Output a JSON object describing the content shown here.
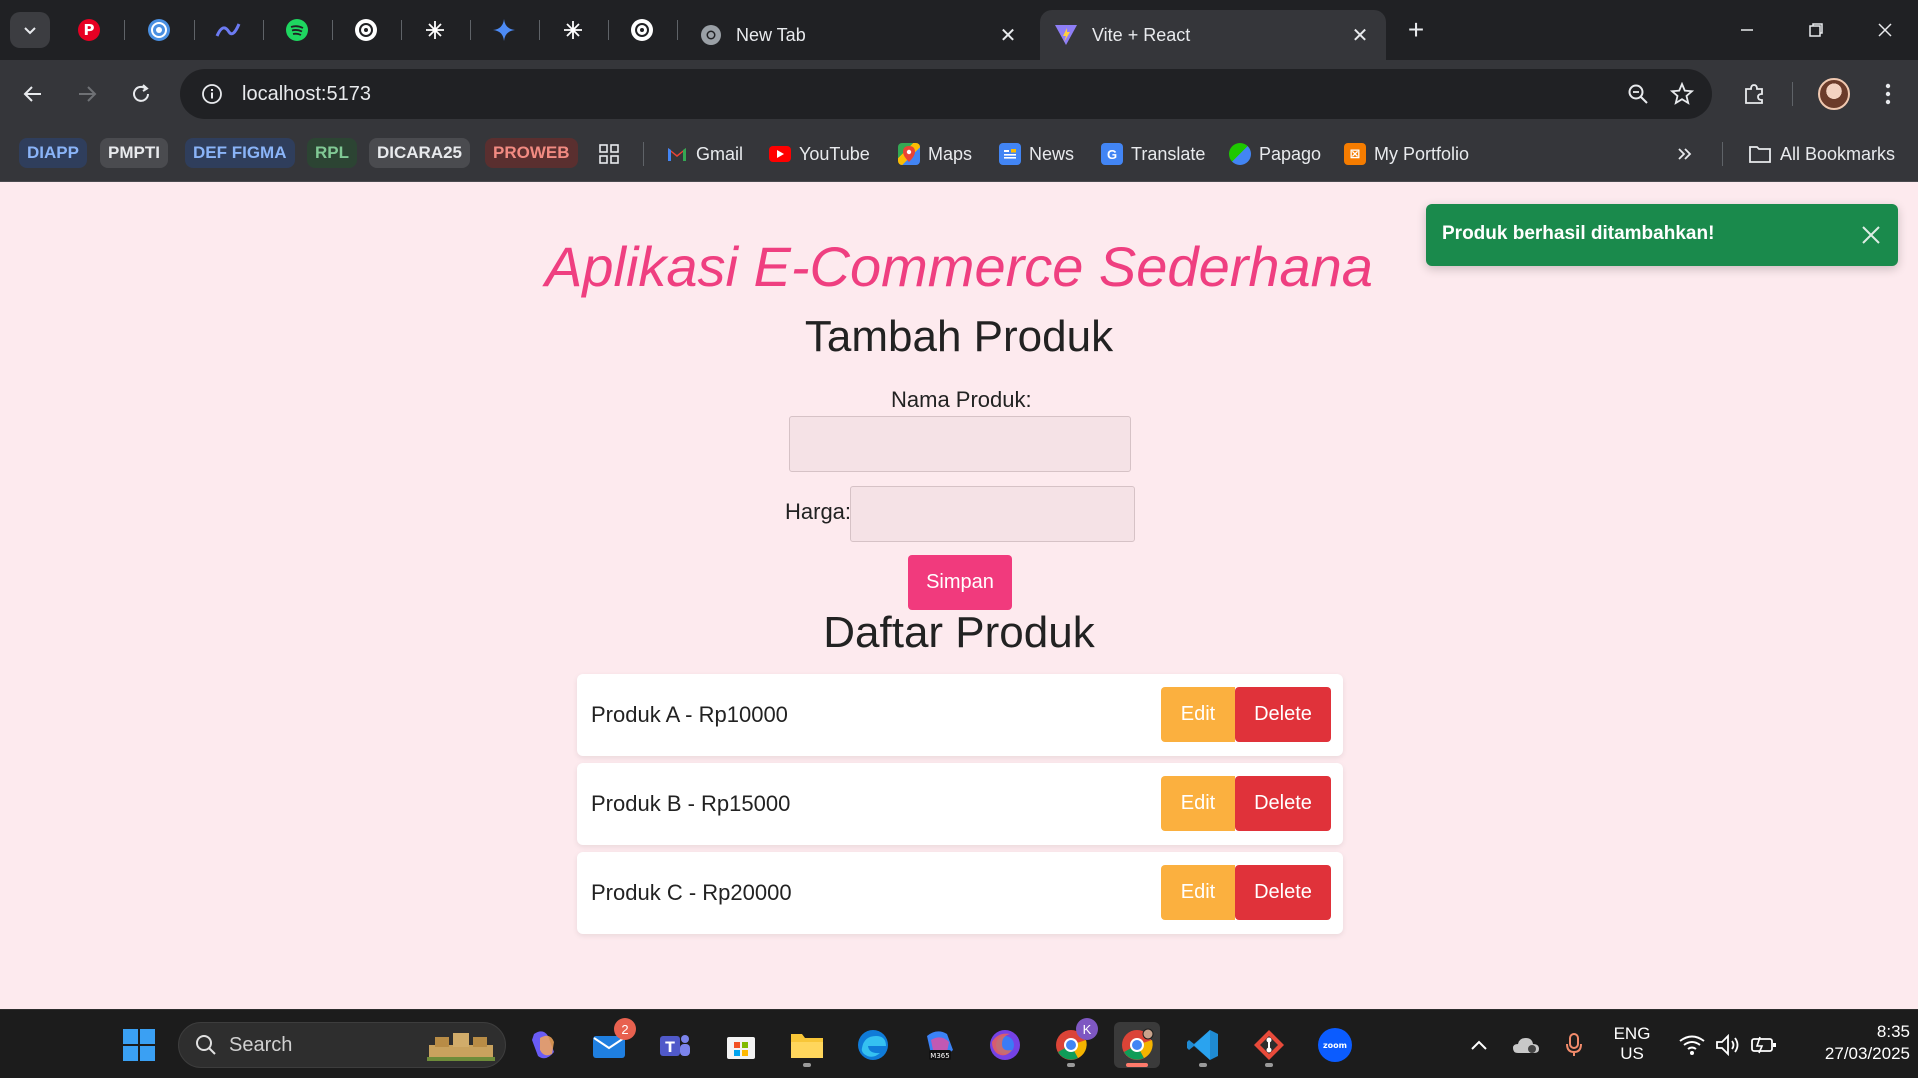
{
  "browser": {
    "tabs": [
      {
        "title": "New Tab",
        "active": false
      },
      {
        "title": "Vite + React",
        "active": true
      }
    ],
    "pinned_tabs": [
      "pinterest-icon",
      "target-icon",
      "pen-icon",
      "spotify-icon",
      "chatgpt-icon",
      "claude-icon",
      "gemini-icon",
      "claude-icon",
      "chatgpt-icon"
    ],
    "address": "localhost:5173",
    "bookmark_groups": [
      {
        "label": "DIAPP",
        "color": "#8ab4f8",
        "bg": "#2f3e5c"
      },
      {
        "label": "PMPTI",
        "color": "#e8eaed",
        "bg": "#4a4b4f"
      },
      {
        "label": "DEF FIGMA",
        "color": "#8ab4f8",
        "bg": "#2f3e5c"
      },
      {
        "label": "RPL",
        "color": "#81c995",
        "bg": "#2c4433"
      },
      {
        "label": "DICARA25",
        "color": "#e8eaed",
        "bg": "#4a4b4f"
      },
      {
        "label": "PROWEB",
        "color": "#f28b82",
        "bg": "#5a2f2f"
      }
    ],
    "bookmarks": [
      {
        "label": "Gmail",
        "icon": "gmail-icon"
      },
      {
        "label": "YouTube",
        "icon": "youtube-icon"
      },
      {
        "label": "Maps",
        "icon": "maps-icon"
      },
      {
        "label": "News",
        "icon": "news-icon"
      },
      {
        "label": "Translate",
        "icon": "translate-icon"
      },
      {
        "label": "Papago",
        "icon": "papago-icon"
      },
      {
        "label": "My Portfolio",
        "icon": "portfolio-icon"
      }
    ],
    "all_bookmarks": "All Bookmarks"
  },
  "app": {
    "title": "Aplikasi E-Commerce Sederhana",
    "form_title": "Tambah Produk",
    "name_label": "Nama Produk:",
    "name_value": "",
    "price_label": "Harga:",
    "price_value": "",
    "save_label": "Simpan",
    "list_title": "Daftar Produk",
    "edit_label": "Edit",
    "delete_label": "Delete",
    "products": [
      {
        "text": "Produk A - Rp10000"
      },
      {
        "text": "Produk B - Rp15000"
      },
      {
        "text": "Produk C - Rp20000"
      }
    ],
    "toast": "Produk berhasil ditambahkan!",
    "accent_color": "#ef3f80",
    "toast_color": "#1a8a4c"
  },
  "taskbar": {
    "search_label": "Search",
    "mail_badge": "2",
    "chrome_badge": "K",
    "language": "ENG",
    "region": "US",
    "time": "8:35",
    "date": "27/03/2025"
  }
}
